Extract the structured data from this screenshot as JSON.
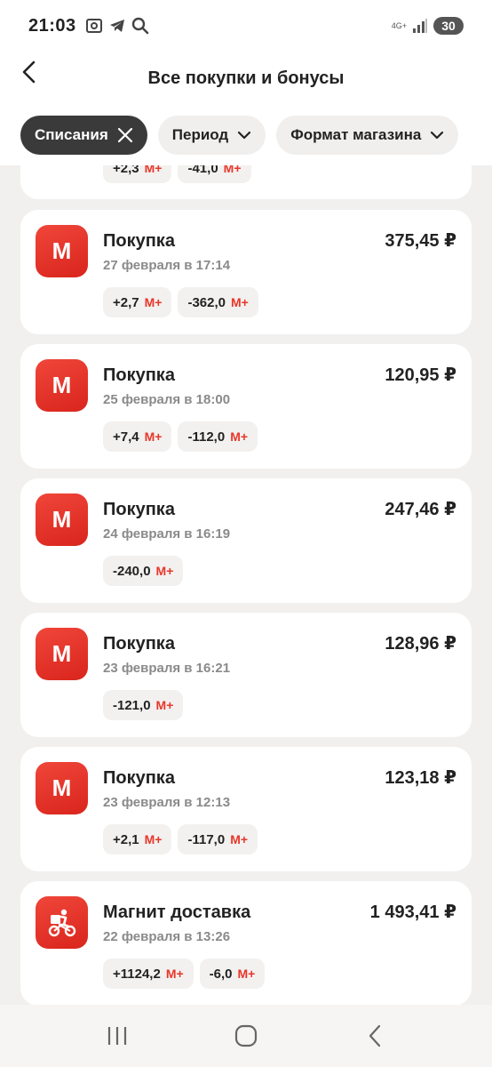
{
  "status_bar": {
    "time": "21:03",
    "network": "4G+",
    "battery": "30",
    "icons": [
      "screenshot-icon",
      "telegram-icon",
      "search-icon",
      "signal-icon"
    ]
  },
  "header": {
    "title": "Все покупки и бонусы",
    "back_icon": "chevron-left-icon"
  },
  "filters": [
    {
      "label": "Списания",
      "active": true,
      "icon": "close-icon"
    },
    {
      "label": "Период",
      "active": false,
      "icon": "chevron-down-icon"
    },
    {
      "label": "Формат магазина",
      "active": false,
      "icon": "chevron-down-icon"
    }
  ],
  "partial_card": {
    "badges": [
      {
        "value": "+2,3",
        "unit": "М+"
      },
      {
        "value": "-41,0",
        "unit": "М+"
      }
    ]
  },
  "transactions": [
    {
      "title": "Покупка",
      "date": "27 февраля в 17:14",
      "amount": "375,45 ₽",
      "icon": "magnit-m-icon",
      "badges": [
        {
          "value": "+2,7",
          "unit": "М+"
        },
        {
          "value": "-362,0",
          "unit": "М+"
        }
      ]
    },
    {
      "title": "Покупка",
      "date": "25 февраля в 18:00",
      "amount": "120,95 ₽",
      "icon": "magnit-m-icon",
      "badges": [
        {
          "value": "+7,4",
          "unit": "М+"
        },
        {
          "value": "-112,0",
          "unit": "М+"
        }
      ]
    },
    {
      "title": "Покупка",
      "date": "24 февраля в 16:19",
      "amount": "247,46 ₽",
      "icon": "magnit-m-icon",
      "badges": [
        {
          "value": "-240,0",
          "unit": "М+"
        }
      ]
    },
    {
      "title": "Покупка",
      "date": "23 февраля в 16:21",
      "amount": "128,96 ₽",
      "icon": "magnit-m-icon",
      "badges": [
        {
          "value": "-121,0",
          "unit": "М+"
        }
      ]
    },
    {
      "title": "Покупка",
      "date": "23 февраля в 12:13",
      "amount": "123,18 ₽",
      "icon": "magnit-m-icon",
      "badges": [
        {
          "value": "+2,1",
          "unit": "М+"
        },
        {
          "value": "-117,0",
          "unit": "М+"
        }
      ]
    },
    {
      "title": "Магнит доставка",
      "date": "22 февраля в 13:26",
      "amount": "1 493,41 ₽",
      "icon": "delivery-courier-icon",
      "badges": [
        {
          "value": "+1124,2",
          "unit": "М+"
        },
        {
          "value": "-6,0",
          "unit": "М+"
        }
      ]
    }
  ],
  "nav_bar": {
    "buttons": [
      "recent-apps-icon",
      "home-icon",
      "back-icon"
    ]
  },
  "colors": {
    "accent_red": "#e8362a",
    "chip_active": "#3a3a3a",
    "background": "#f1f0ee"
  }
}
